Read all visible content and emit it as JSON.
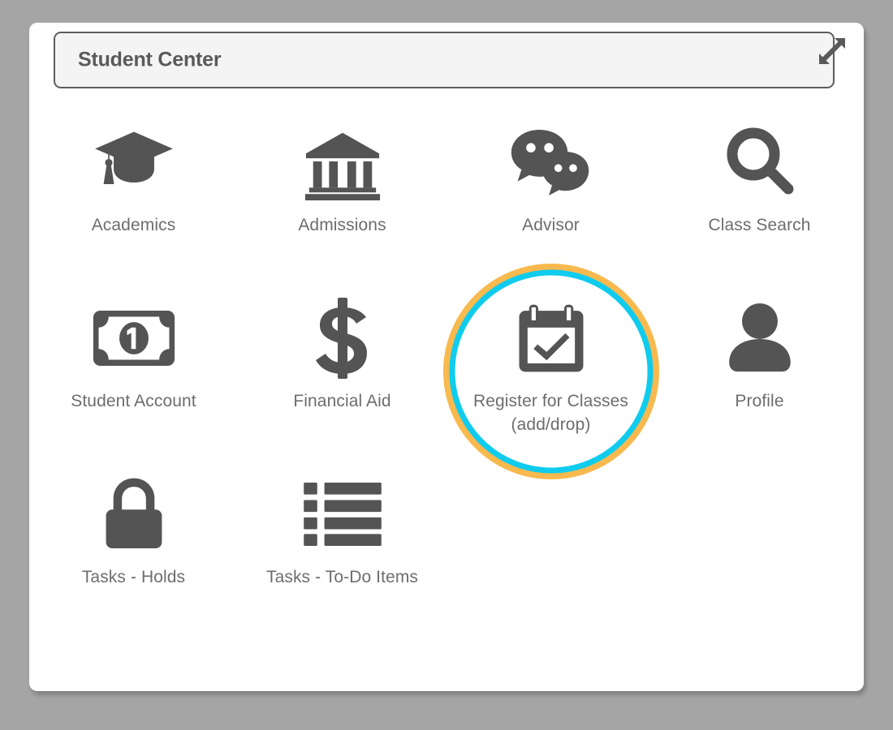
{
  "window": {
    "background_color": "#a5a5a5",
    "card_color": "#ffffff"
  },
  "header": {
    "title": "Student Center",
    "expand_icon": "expand-diagonal-arrows-icon",
    "background_color": "#f4f4f4",
    "border_color": "#5d5d5d",
    "text_color": "#5a5a5a"
  },
  "highlight": {
    "outer_ring_color": "#f8b94e",
    "inner_ring_color": "#0fccee",
    "target_label": "Register for Classes (add/drop)"
  },
  "tiles": [
    {
      "label": "Academics",
      "icon": "graduation-cap-icon",
      "highlighted": false
    },
    {
      "label": "Admissions",
      "icon": "bank-building-icon",
      "highlighted": false
    },
    {
      "label": "Advisor",
      "icon": "chat-bubbles-icon",
      "highlighted": false
    },
    {
      "label": "Class Search",
      "icon": "magnifying-glass-icon",
      "highlighted": false
    },
    {
      "label": "Student Account",
      "icon": "banknote-icon",
      "highlighted": false
    },
    {
      "label": "Financial Aid",
      "icon": "dollar-sign-icon",
      "highlighted": false
    },
    {
      "label": "Register for Classes\n(add/drop)",
      "icon": "calendar-check-icon",
      "highlighted": true
    },
    {
      "label": "Profile",
      "icon": "person-icon",
      "highlighted": false
    },
    {
      "label": "Tasks - Holds",
      "icon": "padlock-icon",
      "highlighted": false
    },
    {
      "label": "Tasks - To-Do Items",
      "icon": "list-items-icon",
      "highlighted": false
    }
  ],
  "icon_color": "#545454"
}
